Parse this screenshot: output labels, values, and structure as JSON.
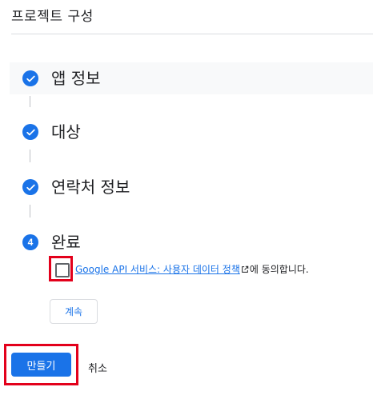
{
  "header": {
    "title": "프로젝트 구성"
  },
  "steps": [
    {
      "number": "",
      "label": "앱 정보",
      "status": "completed",
      "icon": "check-icon"
    },
    {
      "number": "",
      "label": "대상",
      "status": "completed",
      "icon": "check-icon"
    },
    {
      "number": "",
      "label": "연락처 정보",
      "status": "completed",
      "icon": "check-icon"
    },
    {
      "number": "4",
      "label": "완료",
      "status": "active"
    }
  ],
  "consent": {
    "checked": false,
    "link_text": "Google API 서비스: 사용자 데이터 정책",
    "suffix": "에 동의합니다.",
    "link_icon": "external-link-icon"
  },
  "buttons": {
    "continue": "계속",
    "create": "만들기",
    "cancel": "취소"
  },
  "colors": {
    "accent": "#1a73e8",
    "highlight_border": "#e3001b",
    "divider": "#dadce0"
  }
}
